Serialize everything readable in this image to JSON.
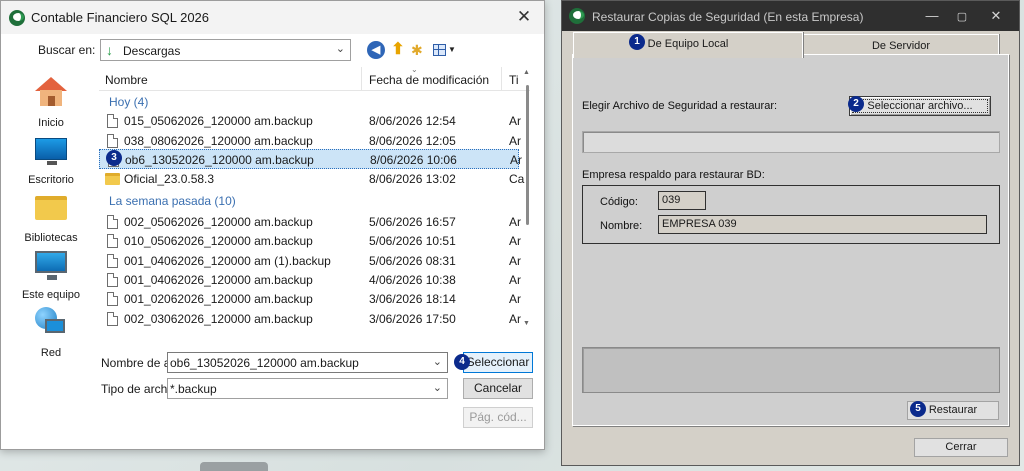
{
  "file_dialog": {
    "title": "Contable Financiero SQL 2026",
    "look_in_label": "Buscar en:",
    "look_in_value": "Descargas",
    "places": [
      "Inicio",
      "Escritorio",
      "Bibliotecas",
      "Este equipo",
      "Red"
    ],
    "columns": {
      "name": "Nombre",
      "date": "Fecha de modificación",
      "type": "Ti"
    },
    "groups": {
      "today": "Hoy (4)",
      "last_week": "La semana pasada (10)"
    },
    "rows": [
      {
        "name": "015_05062026_120000 am.backup",
        "date": "8/06/2026 12:54",
        "type": "Ar"
      },
      {
        "name": "038_08062026_120000 am.backup",
        "date": "8/06/2026 12:05",
        "type": "Ar"
      },
      {
        "name": "ob6_13052026_120000 am.backup",
        "date": "8/06/2026 10:06",
        "type": "Ar"
      },
      {
        "name": "Oficial_23.0.58.3",
        "date": "8/06/2026 13:02",
        "type": "Ca"
      },
      {
        "name": "002_05062026_120000 am.backup",
        "date": "5/06/2026 16:57",
        "type": "Ar"
      },
      {
        "name": "010_05062026_120000 am.backup",
        "date": "5/06/2026 10:51",
        "type": "Ar"
      },
      {
        "name": "001_04062026_120000 am (1).backup",
        "date": "5/06/2026 08:31",
        "type": "Ar"
      },
      {
        "name": "001_04062026_120000 am.backup",
        "date": "4/06/2026 10:38",
        "type": "Ar"
      },
      {
        "name": "001_02062026_120000 am.backup",
        "date": "3/06/2026 18:14",
        "type": "Ar"
      },
      {
        "name": "002_03062026_120000 am.backup",
        "date": "3/06/2026 17:50",
        "type": "Ar"
      }
    ],
    "filename_label": "Nombre de archivo:",
    "filename_value": "ob6_13052026_120000 am.backup",
    "filetype_label": "Tipo de archivos:",
    "filetype_value": "*.backup",
    "btn_select": "Seleccionar",
    "btn_cancel": "Cancelar",
    "btn_page": "Pág. cód..."
  },
  "restore_dialog": {
    "title": "Restaurar Copias de Seguridad (En esta Empresa)",
    "tab_local": "De Equipo Local",
    "tab_server": "De Servidor",
    "choose_label": "Elegir Archivo de Seguridad a restaurar:",
    "btn_select_file": "Seleccionar archivo...",
    "path_value": "",
    "company_section_label": "Empresa respaldo para restaurar BD:",
    "code_label": "Código:",
    "code_value": "039",
    "name_label": "Nombre:",
    "name_value": "EMPRESA 039",
    "btn_restore": "Restaurar",
    "btn_close": "Cerrar"
  },
  "badges": [
    "1",
    "2",
    "3",
    "4",
    "5"
  ],
  "colors": {
    "badge": "#0b2a8c",
    "selection": "#cce4f7",
    "group_header": "#3a6fb0"
  }
}
